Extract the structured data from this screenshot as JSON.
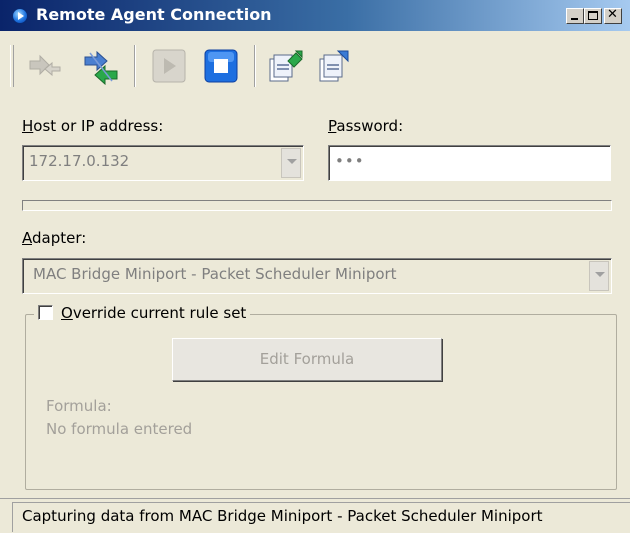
{
  "window": {
    "title": "Remote Agent Connection",
    "title_icon": "agent-play-icon",
    "controls": {
      "minimize": "_",
      "maximize": "□",
      "close": "✕"
    }
  },
  "toolbar": {
    "tools": [
      {
        "name": "connect",
        "icon": "connect-arrows-icon",
        "enabled": false
      },
      {
        "name": "disconnect",
        "icon": "exchange-arrows-icon",
        "enabled": true
      },
      {
        "name": "start",
        "icon": "play-icon",
        "enabled": false
      },
      {
        "name": "stop",
        "icon": "stop-icon",
        "enabled": true
      },
      {
        "name": "export",
        "icon": "export-files-icon",
        "enabled": true
      },
      {
        "name": "import",
        "icon": "import-files-icon",
        "enabled": true
      }
    ]
  },
  "host": {
    "label_underlined": "H",
    "label_rest": "ost or IP address:",
    "value": "172.17.0.132"
  },
  "password": {
    "label_underlined": "P",
    "label_rest": "assword:",
    "value": "•••"
  },
  "adapter": {
    "label_underlined": "A",
    "label_rest": "dapter:",
    "value": "MAC Bridge Miniport - Packet Scheduler Miniport"
  },
  "override": {
    "label_underlined": "O",
    "label_rest": "verride current rule set",
    "checked": false
  },
  "formula": {
    "button_label": "Edit Formula",
    "caption": "Formula:",
    "value": "No formula entered"
  },
  "status": {
    "text": "Capturing data from MAC Bridge Miniport - Packet Scheduler Miniport"
  },
  "colors": {
    "title_start": "#0a246a",
    "title_end": "#a6caf0",
    "face": "#ece9d8",
    "disabled_text": "#a3a09a",
    "stop_blue": "#1d6fe0",
    "arrow_green": "#2aa84a"
  }
}
